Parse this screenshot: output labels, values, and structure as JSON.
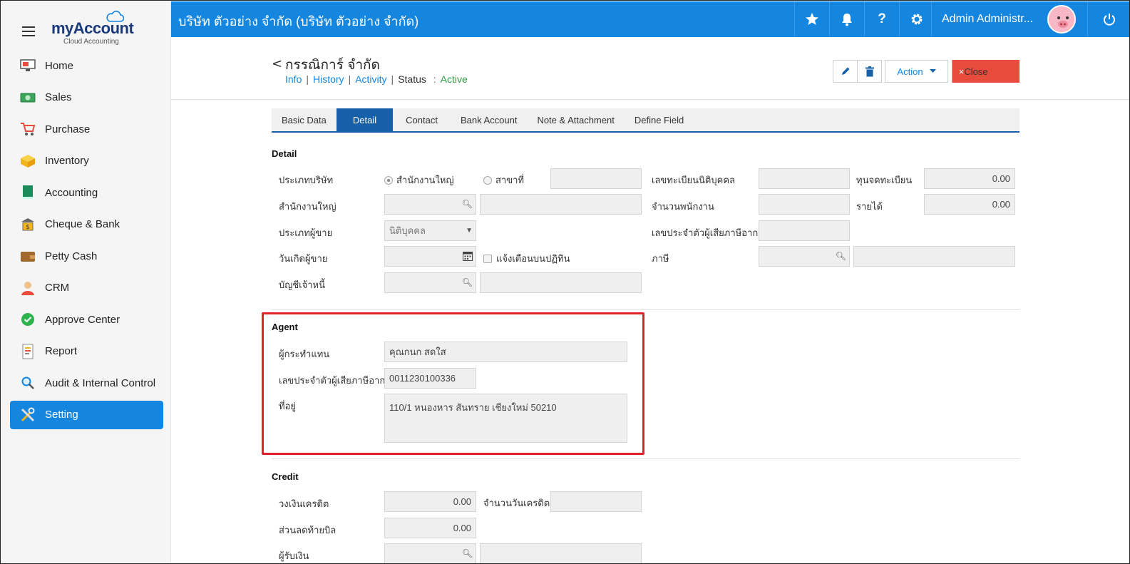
{
  "topbar": {
    "company": "บริษัท ตัวอย่าง จำกัด (บริษัท ตัวอย่าง จำกัด)",
    "user": "Admin Administr..."
  },
  "brand": {
    "name_my": "my",
    "name_account": "Account",
    "subtitle": "Cloud Accounting"
  },
  "sidebar": {
    "items": [
      {
        "label": "Home",
        "icon": "monitor-icon"
      },
      {
        "label": "Sales",
        "icon": "money-icon"
      },
      {
        "label": "Purchase",
        "icon": "cart-icon"
      },
      {
        "label": "Inventory",
        "icon": "box-icon"
      },
      {
        "label": "Accounting",
        "icon": "book-icon"
      },
      {
        "label": "Cheque & Bank",
        "icon": "bank-icon"
      },
      {
        "label": "Petty Cash",
        "icon": "wallet-icon"
      },
      {
        "label": "CRM",
        "icon": "person-icon"
      },
      {
        "label": "Approve Center",
        "icon": "check-circle-icon"
      },
      {
        "label": "Report",
        "icon": "report-icon"
      },
      {
        "label": "Audit & Internal Control",
        "icon": "magnifier-icon"
      },
      {
        "label": "Setting",
        "icon": "tools-icon",
        "active": true
      }
    ]
  },
  "header": {
    "back": "<",
    "title": "กรรณิการ์ จำกัด",
    "links": {
      "info": "Info",
      "history": "History",
      "activity": "Activity"
    },
    "status_label": "Status",
    "status_colon": ":",
    "status_value": "Active",
    "action_label": "Action",
    "close_label": "Close",
    "close_x": "×"
  },
  "tabs": [
    "Basic Data",
    "Detail",
    "Contact",
    "Bank Account",
    "Note & Attachment",
    "Define Field"
  ],
  "detail": {
    "title": "Detail",
    "company_type_label": "ประเภทบริษัท",
    "radio_head_office": "สำนักงานใหญ่",
    "radio_branch": "สาขาที่",
    "head_office_label": "สำนักงานใหญ่",
    "vendor_type_label": "ประเภทผู้ขาย",
    "vendor_type_value": "นิติบุคคล",
    "birthday_label": "วันเกิดผู้ขาย",
    "notify_label": "แจ้งเตือนบนปฏิทิน",
    "payable_label": "บัญชีเจ้าหนี้",
    "reg_no_label": "เลขทะเบียนนิติบุคคล",
    "employees_label": "จำนวนพนักงาน",
    "tax_id_label": "เลขประจำตัวผู้เสียภาษีอากร",
    "tax_label": "ภาษี",
    "capital_label": "ทุนจดทะเบียน",
    "capital_value": "0.00",
    "income_label": "รายได้",
    "income_value": "0.00"
  },
  "agent": {
    "title": "Agent",
    "agent_label": "ผู้กระทำแทน",
    "agent_value": "คุณกนก สดใส",
    "tax_id_label": "เลขประจำตัวผู้เสียภาษีอากร",
    "tax_id_value": "0011230100336",
    "address_label": "ที่อยู่",
    "address_value": "110/1 หนองหาร สันทราย เชียงใหม่ 50210"
  },
  "credit": {
    "title": "Credit",
    "limit_label": "วงเงินเครดิต",
    "limit_value": "0.00",
    "days_label": "จำนวนวันเครดิต",
    "discount_label": "ส่วนลดท้ายบิล",
    "discount_value": "0.00",
    "receiver_label": "ผู้รับเงิน"
  }
}
